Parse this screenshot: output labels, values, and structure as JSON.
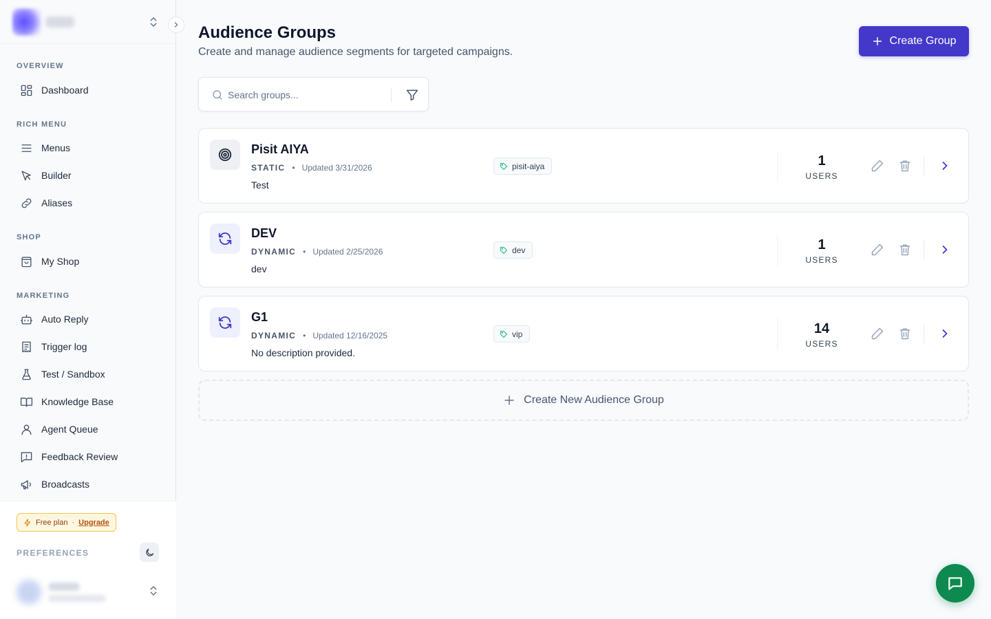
{
  "sidebar": {
    "sections": [
      {
        "label": "OVERVIEW",
        "items": [
          {
            "label": "Dashboard",
            "icon": "dashboard-icon"
          }
        ]
      },
      {
        "label": "RICH MENU",
        "items": [
          {
            "label": "Menus",
            "icon": "menu-icon"
          },
          {
            "label": "Builder",
            "icon": "builder-icon"
          },
          {
            "label": "Aliases",
            "icon": "link-icon"
          }
        ]
      },
      {
        "label": "SHOP",
        "items": [
          {
            "label": "My Shop",
            "icon": "shopping-bag-icon"
          }
        ]
      },
      {
        "label": "MARKETING",
        "items": [
          {
            "label": "Auto Reply",
            "icon": "bot-icon"
          },
          {
            "label": "Trigger log",
            "icon": "receipt-icon"
          },
          {
            "label": "Test / Sandbox",
            "icon": "flask-icon"
          },
          {
            "label": "Knowledge Base",
            "icon": "book-icon"
          },
          {
            "label": "Agent Queue",
            "icon": "user-icon"
          },
          {
            "label": "Feedback Review",
            "icon": "message-alert-icon"
          },
          {
            "label": "Broadcasts",
            "icon": "megaphone-icon"
          }
        ]
      }
    ],
    "footer": {
      "plan": "Free plan",
      "separator": "·",
      "upgrade": "Upgrade",
      "preferences": "PREFERENCES"
    }
  },
  "main": {
    "title": "Audience Groups",
    "subtitle": "Create and manage audience segments for targeted campaigns.",
    "create_button": "Create Group",
    "search": {
      "placeholder": "Search groups..."
    },
    "groups": [
      {
        "name": "Pisit AIYA",
        "type": "STATIC",
        "updated": "Updated 3/31/2026",
        "description": "Test",
        "tag": "pisit-aiya",
        "count": "1",
        "count_label": "USERS",
        "icon": "target-icon"
      },
      {
        "name": "DEV",
        "type": "DYNAMIC",
        "updated": "Updated 2/25/2026",
        "description": "dev",
        "tag": "dev",
        "count": "1",
        "count_label": "USERS",
        "icon": "refresh-icon"
      },
      {
        "name": "G1",
        "type": "DYNAMIC",
        "updated": "Updated 12/16/2025",
        "description": "No description provided.",
        "tag": "vip",
        "count": "14",
        "count_label": "USERS",
        "icon": "refresh-icon"
      }
    ],
    "new_group_label": "Create New Audience Group",
    "meta_separator": "•"
  },
  "colors": {
    "accent": "#4338ca",
    "chat_fab": "#0d8a4f",
    "tag_icon": "#10b981"
  }
}
